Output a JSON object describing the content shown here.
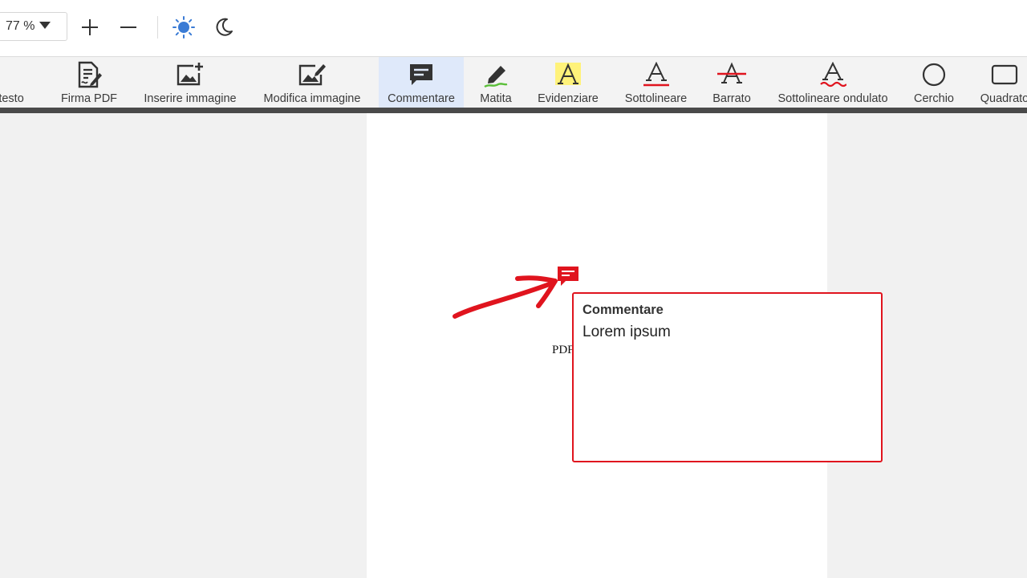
{
  "topbar": {
    "zoom_value": "77 %",
    "icons": [
      "chevron-down-icon",
      "plus-icon",
      "minus-icon",
      "sun-icon",
      "moon-icon"
    ]
  },
  "toolbar": {
    "tools": [
      {
        "label": "e testo",
        "icon": "add-text-icon"
      },
      {
        "label": "Firma PDF",
        "icon": "sign-document-icon"
      },
      {
        "label": "Inserire immagine",
        "icon": "add-image-icon"
      },
      {
        "label": "Modifica immagine",
        "icon": "edit-image-icon"
      },
      {
        "label": "Commentare",
        "icon": "comment-icon",
        "active": true
      },
      {
        "label": "Matita",
        "icon": "pencil-icon"
      },
      {
        "label": "Evidenziare",
        "icon": "highlight-icon"
      },
      {
        "label": "Sottolineare",
        "icon": "underline-icon"
      },
      {
        "label": "Barrato",
        "icon": "strikethrough-icon"
      },
      {
        "label": "Sottolineare ondulato",
        "icon": "wavy-underline-icon"
      },
      {
        "label": "Cerchio",
        "icon": "circle-icon"
      },
      {
        "label": "Quadrato",
        "icon": "square-icon"
      }
    ]
  },
  "document": {
    "visible_text": "PDF"
  },
  "comment": {
    "title": "Commentare",
    "body": "Lorem ipsum"
  },
  "colors": {
    "accent_red": "#e0141e",
    "active_tool_bg": "#dfe9fa",
    "sun_blue": "#3a7bd5",
    "highlight_yellow": "#fff27a",
    "pencil_green": "#5bbf3a"
  }
}
